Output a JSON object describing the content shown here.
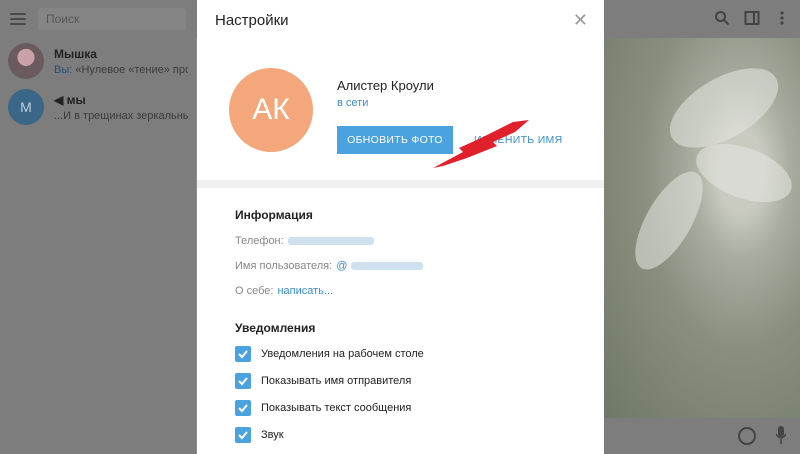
{
  "sidebar": {
    "search_placeholder": "Поиск",
    "chats": [
      {
        "name": "Мышка",
        "sender": "Вы:",
        "message": "«Нулевое «тение» проект"
      },
      {
        "name": "мы",
        "avatar_letter": "М",
        "message": "...И в трещинах зеркальный ку"
      }
    ]
  },
  "modal": {
    "title": "Настройки",
    "close_icon": "close-icon",
    "profile": {
      "initials": "АК",
      "avatar_color": "#f4a77a",
      "name": "Алистер Кроули",
      "status": "в сети",
      "update_photo": "ОБНОВИТЬ ФОТО",
      "change_name": "ИЗМЕНИТЬ ИМЯ"
    },
    "info": {
      "heading": "Информация",
      "phone_label": "Телефон:",
      "username_label": "Имя пользователя:",
      "username_prefix": "@",
      "about_label": "О себе:",
      "about_link": "написать..."
    },
    "notifications": {
      "heading": "Уведомления",
      "items": [
        {
          "label": "Уведомления на рабочем столе",
          "checked": true
        },
        {
          "label": "Показывать имя отправителя",
          "checked": true
        },
        {
          "label": "Показывать текст сообщения",
          "checked": true
        },
        {
          "label": "Звук",
          "checked": true
        }
      ]
    }
  },
  "colors": {
    "accent": "#4aa3df",
    "link": "#3a8ccf",
    "arrow": "#e0202a"
  }
}
